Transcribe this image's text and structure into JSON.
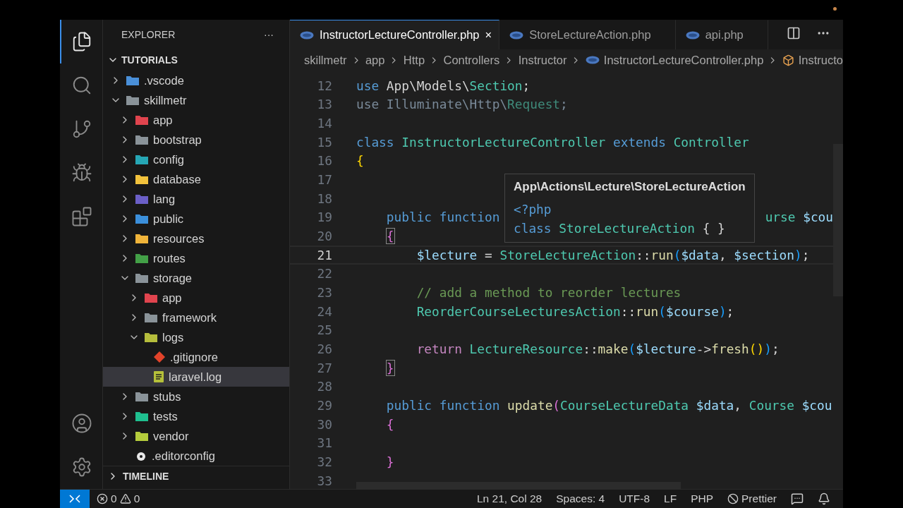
{
  "activity_bar": {
    "items": [
      {
        "kind": "explorer",
        "selected": true
      },
      {
        "kind": "search",
        "selected": false
      },
      {
        "kind": "source-control",
        "selected": false
      },
      {
        "kind": "run",
        "selected": false
      },
      {
        "kind": "extensions",
        "selected": false
      }
    ],
    "bottom": [
      {
        "kind": "account"
      },
      {
        "kind": "settings"
      }
    ]
  },
  "sidebar": {
    "title": "EXPLORER",
    "more": "···",
    "root": "TUTORIALS",
    "tree": [
      {
        "label": ".vscode",
        "kind": "folder",
        "color": "#4a90d9",
        "expanded": false,
        "selected": false
      },
      {
        "label": "skillmetr",
        "kind": "folder",
        "color": "#8a9399",
        "expanded": true,
        "selected": false,
        "children": [
          {
            "label": "app",
            "kind": "folder",
            "color": "#e0444e",
            "expanded": false,
            "selected": false
          },
          {
            "label": "bootstrap",
            "kind": "folder",
            "color": "#8a9399",
            "expanded": false,
            "selected": false
          },
          {
            "label": "config",
            "kind": "folder",
            "color": "#26a7b5",
            "expanded": false,
            "selected": false
          },
          {
            "label": "database",
            "kind": "folder",
            "color": "#f2c23c",
            "expanded": false,
            "selected": false
          },
          {
            "label": "lang",
            "kind": "folder",
            "color": "#6b5fc7",
            "expanded": false,
            "selected": false
          },
          {
            "label": "public",
            "kind": "folder",
            "color": "#3b8fdb",
            "expanded": false,
            "selected": false
          },
          {
            "label": "resources",
            "kind": "folder",
            "color": "#f0b43a",
            "expanded": false,
            "selected": false
          },
          {
            "label": "routes",
            "kind": "folder",
            "color": "#43a047",
            "expanded": false,
            "selected": false
          },
          {
            "label": "storage",
            "kind": "folder",
            "color": "#8a9399",
            "expanded": true,
            "selected": false,
            "children": [
              {
                "label": "app",
                "kind": "folder",
                "color": "#e0444e",
                "expanded": false,
                "selected": false
              },
              {
                "label": "framework",
                "kind": "folder",
                "color": "#8a9399",
                "expanded": false,
                "selected": false
              },
              {
                "label": "logs",
                "kind": "folder",
                "color": "#b5bd3c",
                "expanded": true,
                "selected": false,
                "children": [
                  {
                    "label": ".gitignore",
                    "kind": "git-file",
                    "selected": false
                  },
                  {
                    "label": "laravel.log",
                    "kind": "log-file",
                    "selected": true
                  }
                ]
              }
            ]
          },
          {
            "label": "stubs",
            "kind": "folder",
            "color": "#8a9399",
            "expanded": false,
            "selected": false
          },
          {
            "label": "tests",
            "kind": "folder",
            "color": "#1fbf8f",
            "expanded": false,
            "selected": false
          },
          {
            "label": "vendor",
            "kind": "folder",
            "color": "#b5cc3c",
            "expanded": false,
            "selected": false
          },
          {
            "label": ".editorconfig",
            "kind": "config-file",
            "selected": false
          }
        ]
      }
    ],
    "timeline": {
      "label": "TIMELINE",
      "expanded": false
    }
  },
  "tabs": [
    {
      "label": "InstructorLectureController.php",
      "selected": true,
      "close": "×"
    },
    {
      "label": "StoreLectureAction.php",
      "selected": false
    },
    {
      "label": "api.php",
      "selected": false
    }
  ],
  "breadcrumb": [
    {
      "label": "skillmetr",
      "kind": "folder"
    },
    {
      "label": "app",
      "kind": "folder"
    },
    {
      "label": "Http",
      "kind": "folder"
    },
    {
      "label": "Controllers",
      "kind": "folder"
    },
    {
      "label": "Instructor",
      "kind": "folder"
    },
    {
      "label": "InstructorLectureController.php",
      "kind": "php-file"
    },
    {
      "label": "Instructo",
      "kind": "class"
    }
  ],
  "editor": {
    "lines": [
      {
        "number": "12",
        "current": false,
        "tokens": [
          {
            "t": "use ",
            "kind": "kw"
          },
          {
            "t": "App\\Models\\",
            "kind": "plain"
          },
          {
            "t": "Section",
            "kind": "type"
          },
          {
            "t": ";",
            "kind": "plain"
          }
        ]
      },
      {
        "number": "13",
        "current": false,
        "tokens": [
          {
            "t": "use Illuminate\\Http\\",
            "kind": "dim"
          },
          {
            "t": "Request",
            "kind": "dimtype"
          },
          {
            "t": ";",
            "kind": "dim"
          }
        ]
      },
      {
        "number": "14",
        "current": false
      },
      {
        "number": "15",
        "current": false,
        "tokens": [
          {
            "t": "class ",
            "kind": "kw"
          },
          {
            "t": "InstructorLectureController",
            "kind": "type"
          },
          {
            "t": " extends ",
            "kind": "kw"
          },
          {
            "t": "Controller",
            "kind": "type"
          }
        ]
      },
      {
        "number": "16",
        "current": false,
        "tokens": [
          {
            "t": "{",
            "kind": "b1"
          }
        ]
      },
      {
        "number": "17",
        "current": false
      },
      {
        "number": "18",
        "current": false
      },
      {
        "number": "19",
        "current": false,
        "tokens": [
          {
            "t": "    public function",
            "kind": "kw"
          }
        ],
        "tail": [
          {
            "t": "urse",
            "kind": "type"
          },
          {
            "t": " $cou",
            "kind": "var"
          }
        ]
      },
      {
        "number": "20",
        "current": false,
        "tokens": [
          {
            "t": "    {",
            "kind": "b2m"
          }
        ]
      },
      {
        "number": "21",
        "current": true,
        "tokens": [
          {
            "t": "        $lecture",
            "kind": "var"
          },
          {
            "t": " = ",
            "kind": "plain"
          },
          {
            "t": "StoreLectureAction",
            "kind": "type"
          },
          {
            "t": "::",
            "kind": "plain"
          },
          {
            "t": "run",
            "kind": "fn"
          },
          {
            "t": "(",
            "kind": "b3"
          },
          {
            "t": "$data",
            "kind": "var"
          },
          {
            "t": ", ",
            "kind": "plain"
          },
          {
            "t": "$section",
            "kind": "var"
          },
          {
            "t": ")",
            "kind": "b3"
          },
          {
            "t": ";",
            "kind": "plain"
          }
        ]
      },
      {
        "number": "22",
        "current": false
      },
      {
        "number": "23",
        "current": false,
        "tokens": [
          {
            "t": "        // add a method to reorder lectures",
            "kind": "comment"
          }
        ]
      },
      {
        "number": "24",
        "current": false,
        "tokens": [
          {
            "t": "        ReorderCourseLecturesAction",
            "kind": "type"
          },
          {
            "t": "::",
            "kind": "plain"
          },
          {
            "t": "run",
            "kind": "fn"
          },
          {
            "t": "(",
            "kind": "b3"
          },
          {
            "t": "$course",
            "kind": "var"
          },
          {
            "t": ")",
            "kind": "b3"
          },
          {
            "t": ";",
            "kind": "plain"
          }
        ]
      },
      {
        "number": "25",
        "current": false
      },
      {
        "number": "26",
        "current": false,
        "tokens": [
          {
            "t": "        return",
            "kind": "ctrl"
          },
          {
            "t": " LectureResource",
            "kind": "type"
          },
          {
            "t": "::",
            "kind": "plain"
          },
          {
            "t": "make",
            "kind": "fn"
          },
          {
            "t": "(",
            "kind": "b3"
          },
          {
            "t": "$lecture",
            "kind": "var"
          },
          {
            "t": "->",
            "kind": "plain"
          },
          {
            "t": "fresh",
            "kind": "fn"
          },
          {
            "t": "()",
            "kind": "b1"
          },
          {
            "t": ")",
            "kind": "b3"
          },
          {
            "t": ";",
            "kind": "plain"
          }
        ]
      },
      {
        "number": "27",
        "current": false,
        "tokens": [
          {
            "t": "    }",
            "kind": "b2m"
          }
        ]
      },
      {
        "number": "28",
        "current": false
      },
      {
        "number": "29",
        "current": false,
        "tokens": [
          {
            "t": "    public function",
            "kind": "kw"
          },
          {
            "t": " update",
            "kind": "fn"
          },
          {
            "t": "(",
            "kind": "b2"
          },
          {
            "t": "CourseLectureData",
            "kind": "type"
          },
          {
            "t": " $data",
            "kind": "var"
          },
          {
            "t": ", ",
            "kind": "plain"
          },
          {
            "t": "Course",
            "kind": "type"
          },
          {
            "t": " $cou",
            "kind": "var"
          }
        ]
      },
      {
        "number": "30",
        "current": false,
        "tokens": [
          {
            "t": "    {",
            "kind": "b2"
          }
        ]
      },
      {
        "number": "31",
        "current": false
      },
      {
        "number": "32",
        "current": false,
        "tokens": [
          {
            "t": "    }",
            "kind": "b2"
          }
        ]
      },
      {
        "number": "33",
        "current": false
      }
    ],
    "hover": {
      "title": "App\\Actions\\Lecture\\StoreLectureAction",
      "lines": [
        [
          {
            "t": "<?php",
            "kind": "kw"
          }
        ],
        [
          {
            "t": "class ",
            "kind": "kw"
          },
          {
            "t": "StoreLectureAction",
            "kind": "type"
          },
          {
            "t": " { }",
            "kind": "plain"
          }
        ]
      ]
    }
  },
  "status_bar": {
    "errors": "0",
    "warnings": "0",
    "items": [
      "Ln 21, Col 28",
      "Spaces: 4",
      "UTF-8",
      "LF",
      "PHP"
    ],
    "formatter": "Prettier"
  }
}
